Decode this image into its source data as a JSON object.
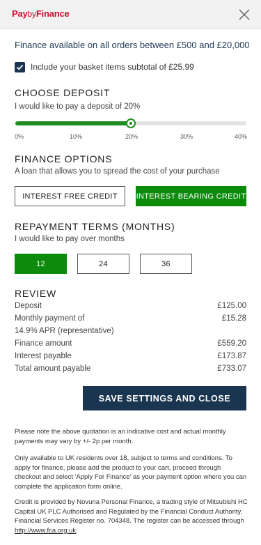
{
  "header": {
    "logo_pay": "Pay",
    "logo_by": "by",
    "logo_finance": "Finance",
    "close_icon": "close-icon"
  },
  "availability": {
    "prefix": "Finance available on all orders between ",
    "min": "£500",
    "joiner": " and ",
    "max": "£20,000"
  },
  "basket": {
    "checked": true,
    "label": "Include your basket items subtotal of £25.99"
  },
  "deposit": {
    "title": "CHOOSE DEPOSIT",
    "subtitle_prefix": "I would like to pay a deposit of ",
    "subtitle_value": "20%",
    "percent": 20,
    "max_percent": 40,
    "ticks": [
      "0%",
      "10%",
      "20%",
      "30%",
      "40%"
    ]
  },
  "finance_options": {
    "title": "FINANCE OPTIONS",
    "subtitle": "A loan that allows you to spread the cost of your purchase",
    "interest_free": "INTEREST FREE CREDIT",
    "interest_bearing": "INTEREST BEARING CREDIT",
    "selected": "interest_bearing"
  },
  "repayment": {
    "title": "REPAYMENT TERMS (MONTHS)",
    "subtitle": "I would like to pay over months",
    "options": [
      "12",
      "24",
      "36"
    ],
    "selected": "12"
  },
  "review": {
    "title": "REVIEW",
    "deposit_label": "Deposit",
    "deposit_value": "£125.00",
    "monthly_label": "Monthly payment of",
    "monthly_value": "£15.28",
    "apr_label": "14.9% APR (representative)",
    "finance_amount_label": "Finance amount",
    "finance_amount_value": "£559.20",
    "interest_label": "Interest payable",
    "interest_value": "£173.87",
    "total_label": "Total amount payable",
    "total_value": "£733.07"
  },
  "save_button": "SAVE SETTINGS AND CLOSE",
  "notes": {
    "quote": "Please note the above quotation is an indicative cost and actual monthly payments may vary by +/- 2p per month.",
    "availability": "Only available to UK residents over 18, subject to terms and conditions. To apply for finance, please add the product to your cart, proceed through checkout and select 'Apply For Finance' as your payment option where you can complete the application form online.",
    "credit": "Credit is provided by Novuna Personal Finance, a trading style of Mitsubishi HC Capital UK PLC Authorised and Regulated by the Financial Conduct Authority. Financial Services Register no. 704348. The register can be accessed through ",
    "link": "http://www.fca.org.uk",
    "end": "."
  },
  "colors": {
    "brand_red": "#c8102e",
    "navy": "#1a3550",
    "green": "#0c8a0c"
  }
}
